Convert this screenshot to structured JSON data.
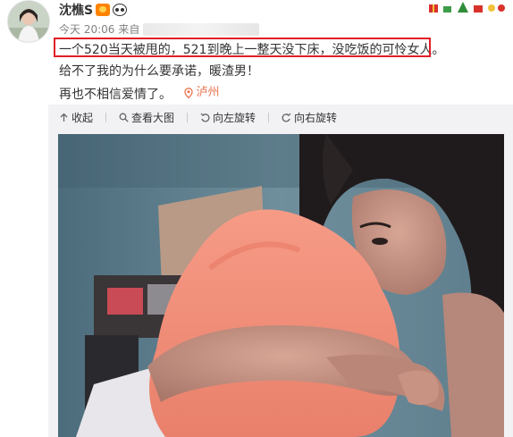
{
  "post": {
    "username": "沈樵S",
    "meta": {
      "time": "今天 20:06",
      "source_prefix": "来自"
    },
    "content": {
      "line1": "一个520当天被甩的，521到晚上一整天没下床，没吃饭的可怜女人。",
      "line2": "给不了我的为什么要承诺，暖渣男！",
      "line3": "再也不相信爱情了。",
      "location": "泸州"
    },
    "media_toolbar": {
      "collapse": "收起",
      "view_large": "查看大图",
      "rotate_left": "向左旋转",
      "rotate_right": "向右旋转"
    }
  },
  "colors": {
    "highlight_border": "#e01f27",
    "location_text": "#eb7350",
    "media_bg": "#f2f2f5"
  },
  "icons": [
    "avatar",
    "vip-badge-icon",
    "panda-badge-icon",
    "festive-decoration",
    "location-pin-icon",
    "collapse-icon",
    "magnifier-icon",
    "rotate-left-icon",
    "rotate-right-icon"
  ]
}
